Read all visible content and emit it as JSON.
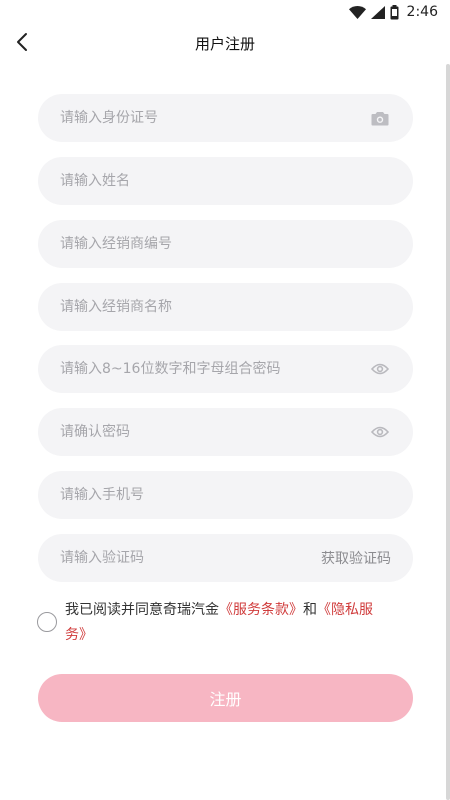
{
  "status_bar": {
    "time": "2:46",
    "icons": [
      "wifi-icon",
      "signal-icon",
      "battery-icon"
    ]
  },
  "header": {
    "title": "用户注册",
    "back_icon": "chevron-left-icon"
  },
  "form": {
    "id_card": {
      "placeholder": "请输入身份证号",
      "icon": "camera-icon"
    },
    "name": {
      "placeholder": "请输入姓名"
    },
    "dealer_code": {
      "placeholder": "请输入经销商编号"
    },
    "dealer_name": {
      "placeholder": "请输入经销商名称"
    },
    "password": {
      "placeholder": "请输入8~16位数字和字母组合密码",
      "icon": "eye-icon"
    },
    "confirm_password": {
      "placeholder": "请确认密码",
      "icon": "eye-icon"
    },
    "phone": {
      "placeholder": "请输入手机号"
    },
    "sms_code": {
      "placeholder": "请输入验证码",
      "send_label": "获取验证码"
    }
  },
  "agreement": {
    "prefix": "我已阅读并同意奇瑞汽金",
    "service_terms": "《服务条款》",
    "connector": "和",
    "privacy_policy": "《隐私服务》",
    "checked": false
  },
  "register_button": {
    "label": "注册"
  },
  "colors": {
    "field_bg": "#f4f4f6",
    "placeholder": "#a6a6ab",
    "link": "#d03c3c",
    "button_disabled": "#f7b6c3"
  }
}
